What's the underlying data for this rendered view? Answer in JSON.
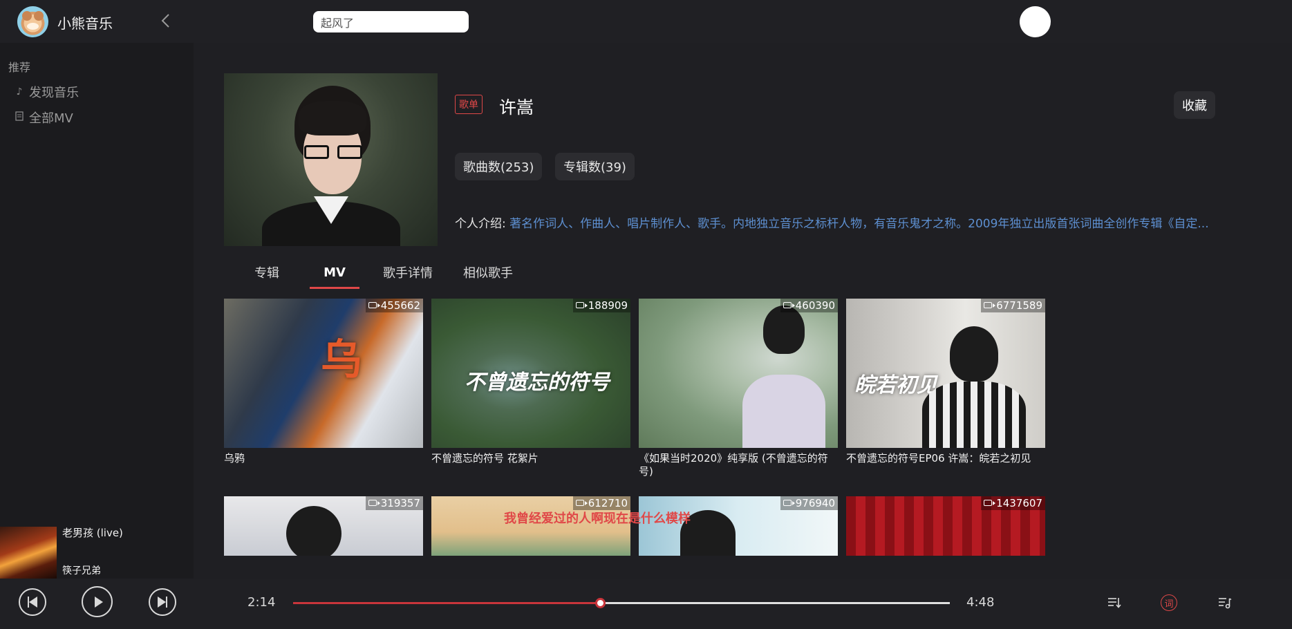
{
  "app": {
    "name": "小熊音乐"
  },
  "search": {
    "value": "起风了"
  },
  "sidebar": {
    "section": "推荐",
    "items": [
      {
        "label": "发现音乐",
        "icon": "music-note-icon"
      },
      {
        "label": "全部MV",
        "icon": "document-icon"
      }
    ]
  },
  "artist": {
    "tag": "歌单",
    "name": "许嵩",
    "favorite_label": "收藏",
    "song_count_label": "歌曲数(253)",
    "album_count_label": "专辑数(39)",
    "intro_label": "个人介绍:",
    "intro_text": "著名作词人、作曲人、唱片制作人、歌手。内地独立音乐之标杆人物，有音乐鬼才之称。2009年独立出版首张词曲全创作专辑《自定..."
  },
  "tabs": [
    {
      "label": "专辑"
    },
    {
      "label": "MV"
    },
    {
      "label": "歌手详情"
    },
    {
      "label": "相似歌手"
    }
  ],
  "mvs": [
    {
      "title": "乌鸦",
      "count": "455662"
    },
    {
      "title": "不曾遗忘的符号 花絮片",
      "count": "188909"
    },
    {
      "title": "《如果当时2020》纯享版 (不曾遗忘的符号)",
      "count": "460390"
    },
    {
      "title": "不曾遗忘的符号EP06 许嵩：皖若之初见",
      "count": "6771589"
    },
    {
      "title": "",
      "count": "319357"
    },
    {
      "title": "",
      "count": "612710"
    },
    {
      "title": "",
      "count": "976940"
    },
    {
      "title": "",
      "count": "1437607"
    }
  ],
  "now_playing": {
    "title": "老男孩 (live)",
    "artist": "筷子兄弟",
    "lyric": "我曾经爱过的人啊现在是什么模样",
    "current_time": "2:14",
    "total_time": "4:48",
    "progress": 0.467,
    "lyric_button": "词"
  },
  "colors": {
    "accent": "#e04848",
    "link": "#5d8fd0",
    "background": "#1f1f23"
  }
}
